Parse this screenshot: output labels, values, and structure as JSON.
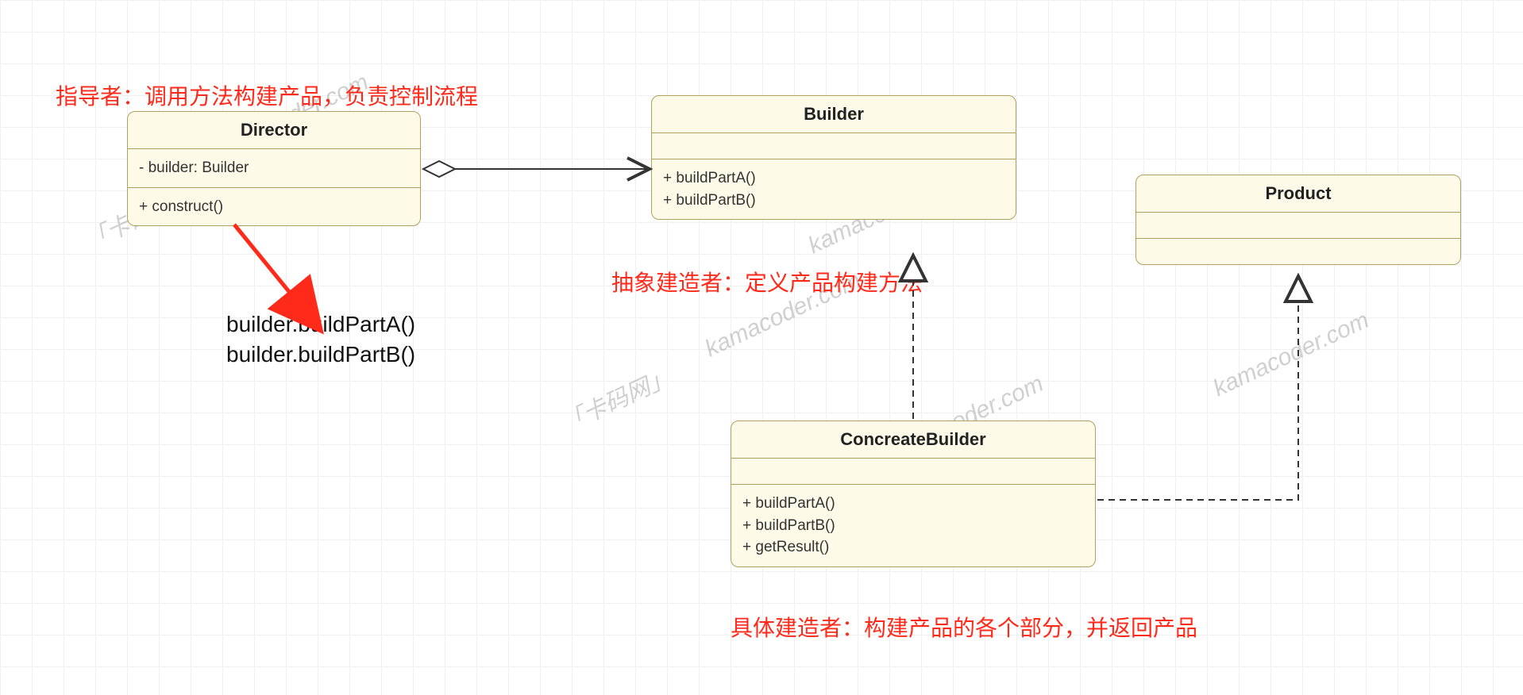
{
  "annotations": {
    "director_note": "指导者：调用方法构建产品，负责控制流程",
    "builder_note": "抽象建造者：定义产品构建方法",
    "concrete_note": "具体建造者：构建产品的各个部分，并返回产品"
  },
  "classes": {
    "director": {
      "name": "Director",
      "attr1": "- builder: Builder",
      "op1": "+ construct()"
    },
    "builder": {
      "name": "Builder",
      "op1": "+ buildPartA()",
      "op2": "+ buildPartB()"
    },
    "product": {
      "name": "Product"
    },
    "concrete": {
      "name": "ConcreateBuilder",
      "op1": "+ buildPartA()",
      "op2": "+ buildPartB()",
      "op3": "+ getResult()"
    }
  },
  "construct_body": {
    "line1": "builder.buildPartA()",
    "line2": "builder.buildPartB()"
  },
  "watermarks": {
    "text_cn": "「卡码网」",
    "text_en": "kamacoder.com"
  }
}
